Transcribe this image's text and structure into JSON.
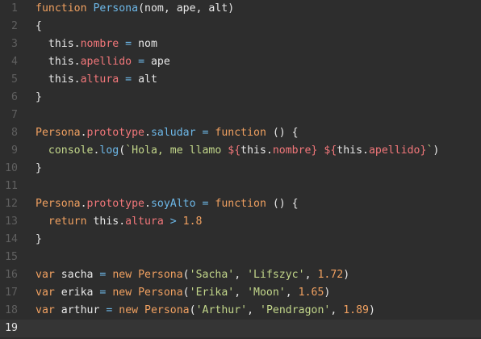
{
  "editor": {
    "current_line": 19,
    "lines": [
      {
        "number": "1",
        "tokens": [
          {
            "type": "keyword",
            "text": "function"
          },
          {
            "type": "plain",
            "text": " "
          },
          {
            "type": "func",
            "text": "Persona"
          },
          {
            "type": "plain",
            "text": "(nom, ape, alt)"
          }
        ]
      },
      {
        "number": "2",
        "tokens": [
          {
            "type": "plain",
            "text": "{"
          }
        ]
      },
      {
        "number": "3",
        "tokens": [
          {
            "type": "plain",
            "text": "  this."
          },
          {
            "type": "prop",
            "text": "nombre"
          },
          {
            "type": "plain",
            "text": " "
          },
          {
            "type": "op",
            "text": "="
          },
          {
            "type": "plain",
            "text": " nom"
          }
        ]
      },
      {
        "number": "4",
        "tokens": [
          {
            "type": "plain",
            "text": "  this."
          },
          {
            "type": "prop",
            "text": "apellido"
          },
          {
            "type": "plain",
            "text": " "
          },
          {
            "type": "op",
            "text": "="
          },
          {
            "type": "plain",
            "text": " ape"
          }
        ]
      },
      {
        "number": "5",
        "tokens": [
          {
            "type": "plain",
            "text": "  this."
          },
          {
            "type": "prop",
            "text": "altura"
          },
          {
            "type": "plain",
            "text": " "
          },
          {
            "type": "op",
            "text": "="
          },
          {
            "type": "plain",
            "text": " alt"
          }
        ]
      },
      {
        "number": "6",
        "tokens": [
          {
            "type": "plain",
            "text": "}"
          }
        ]
      },
      {
        "number": "7",
        "tokens": []
      },
      {
        "number": "8",
        "tokens": [
          {
            "type": "class",
            "text": "Persona"
          },
          {
            "type": "plain",
            "text": "."
          },
          {
            "type": "prop",
            "text": "prototype"
          },
          {
            "type": "plain",
            "text": "."
          },
          {
            "type": "func",
            "text": "saludar"
          },
          {
            "type": "plain",
            "text": " "
          },
          {
            "type": "op",
            "text": "="
          },
          {
            "type": "plain",
            "text": " "
          },
          {
            "type": "keyword",
            "text": "function"
          },
          {
            "type": "plain",
            "text": " () {"
          }
        ]
      },
      {
        "number": "9",
        "tokens": [
          {
            "type": "plain",
            "text": "  "
          },
          {
            "type": "console",
            "text": "console"
          },
          {
            "type": "plain",
            "text": "."
          },
          {
            "type": "func",
            "text": "log"
          },
          {
            "type": "plain",
            "text": "("
          },
          {
            "type": "string",
            "text": "`Hola, me llamo "
          },
          {
            "type": "interp",
            "text": "${"
          },
          {
            "type": "plain",
            "text": "this."
          },
          {
            "type": "prop",
            "text": "nombre"
          },
          {
            "type": "interp",
            "text": "}"
          },
          {
            "type": "string",
            "text": " "
          },
          {
            "type": "interp",
            "text": "${"
          },
          {
            "type": "plain",
            "text": "this."
          },
          {
            "type": "prop",
            "text": "apellido"
          },
          {
            "type": "interp",
            "text": "}"
          },
          {
            "type": "string",
            "text": "`"
          },
          {
            "type": "plain",
            "text": ")"
          }
        ]
      },
      {
        "number": "10",
        "tokens": [
          {
            "type": "plain",
            "text": "}"
          }
        ]
      },
      {
        "number": "11",
        "tokens": []
      },
      {
        "number": "12",
        "tokens": [
          {
            "type": "class",
            "text": "Persona"
          },
          {
            "type": "plain",
            "text": "."
          },
          {
            "type": "prop",
            "text": "prototype"
          },
          {
            "type": "plain",
            "text": "."
          },
          {
            "type": "func",
            "text": "soyAlto"
          },
          {
            "type": "plain",
            "text": " "
          },
          {
            "type": "op",
            "text": "="
          },
          {
            "type": "plain",
            "text": " "
          },
          {
            "type": "keyword",
            "text": "function"
          },
          {
            "type": "plain",
            "text": " () {"
          }
        ]
      },
      {
        "number": "13",
        "tokens": [
          {
            "type": "plain",
            "text": "  "
          },
          {
            "type": "keyword",
            "text": "return"
          },
          {
            "type": "plain",
            "text": " this."
          },
          {
            "type": "prop",
            "text": "altura"
          },
          {
            "type": "plain",
            "text": " "
          },
          {
            "type": "op",
            "text": ">"
          },
          {
            "type": "plain",
            "text": " "
          },
          {
            "type": "number",
            "text": "1.8"
          }
        ]
      },
      {
        "number": "14",
        "tokens": [
          {
            "type": "plain",
            "text": "}"
          }
        ]
      },
      {
        "number": "15",
        "tokens": []
      },
      {
        "number": "16",
        "tokens": [
          {
            "type": "keyword",
            "text": "var"
          },
          {
            "type": "plain",
            "text": " sacha "
          },
          {
            "type": "op",
            "text": "="
          },
          {
            "type": "plain",
            "text": " "
          },
          {
            "type": "keyword",
            "text": "new"
          },
          {
            "type": "plain",
            "text": " "
          },
          {
            "type": "class",
            "text": "Persona"
          },
          {
            "type": "plain",
            "text": "("
          },
          {
            "type": "string",
            "text": "'Sacha'"
          },
          {
            "type": "plain",
            "text": ", "
          },
          {
            "type": "string",
            "text": "'Lifszyc'"
          },
          {
            "type": "plain",
            "text": ", "
          },
          {
            "type": "number",
            "text": "1.72"
          },
          {
            "type": "plain",
            "text": ")"
          }
        ]
      },
      {
        "number": "17",
        "tokens": [
          {
            "type": "keyword",
            "text": "var"
          },
          {
            "type": "plain",
            "text": " erika "
          },
          {
            "type": "op",
            "text": "="
          },
          {
            "type": "plain",
            "text": " "
          },
          {
            "type": "keyword",
            "text": "new"
          },
          {
            "type": "plain",
            "text": " "
          },
          {
            "type": "class",
            "text": "Persona"
          },
          {
            "type": "plain",
            "text": "("
          },
          {
            "type": "string",
            "text": "'Erika'"
          },
          {
            "type": "plain",
            "text": ", "
          },
          {
            "type": "string",
            "text": "'Moon'"
          },
          {
            "type": "plain",
            "text": ", "
          },
          {
            "type": "number",
            "text": "1.65"
          },
          {
            "type": "plain",
            "text": ")"
          }
        ]
      },
      {
        "number": "18",
        "tokens": [
          {
            "type": "keyword",
            "text": "var"
          },
          {
            "type": "plain",
            "text": " arthur "
          },
          {
            "type": "op",
            "text": "="
          },
          {
            "type": "plain",
            "text": " "
          },
          {
            "type": "keyword",
            "text": "new"
          },
          {
            "type": "plain",
            "text": " "
          },
          {
            "type": "class",
            "text": "Persona"
          },
          {
            "type": "plain",
            "text": "("
          },
          {
            "type": "string",
            "text": "'Arthur'"
          },
          {
            "type": "plain",
            "text": ", "
          },
          {
            "type": "string",
            "text": "'Pendragon'"
          },
          {
            "type": "plain",
            "text": ", "
          },
          {
            "type": "number",
            "text": "1.89"
          },
          {
            "type": "plain",
            "text": ")"
          }
        ]
      },
      {
        "number": "19",
        "tokens": []
      }
    ]
  }
}
